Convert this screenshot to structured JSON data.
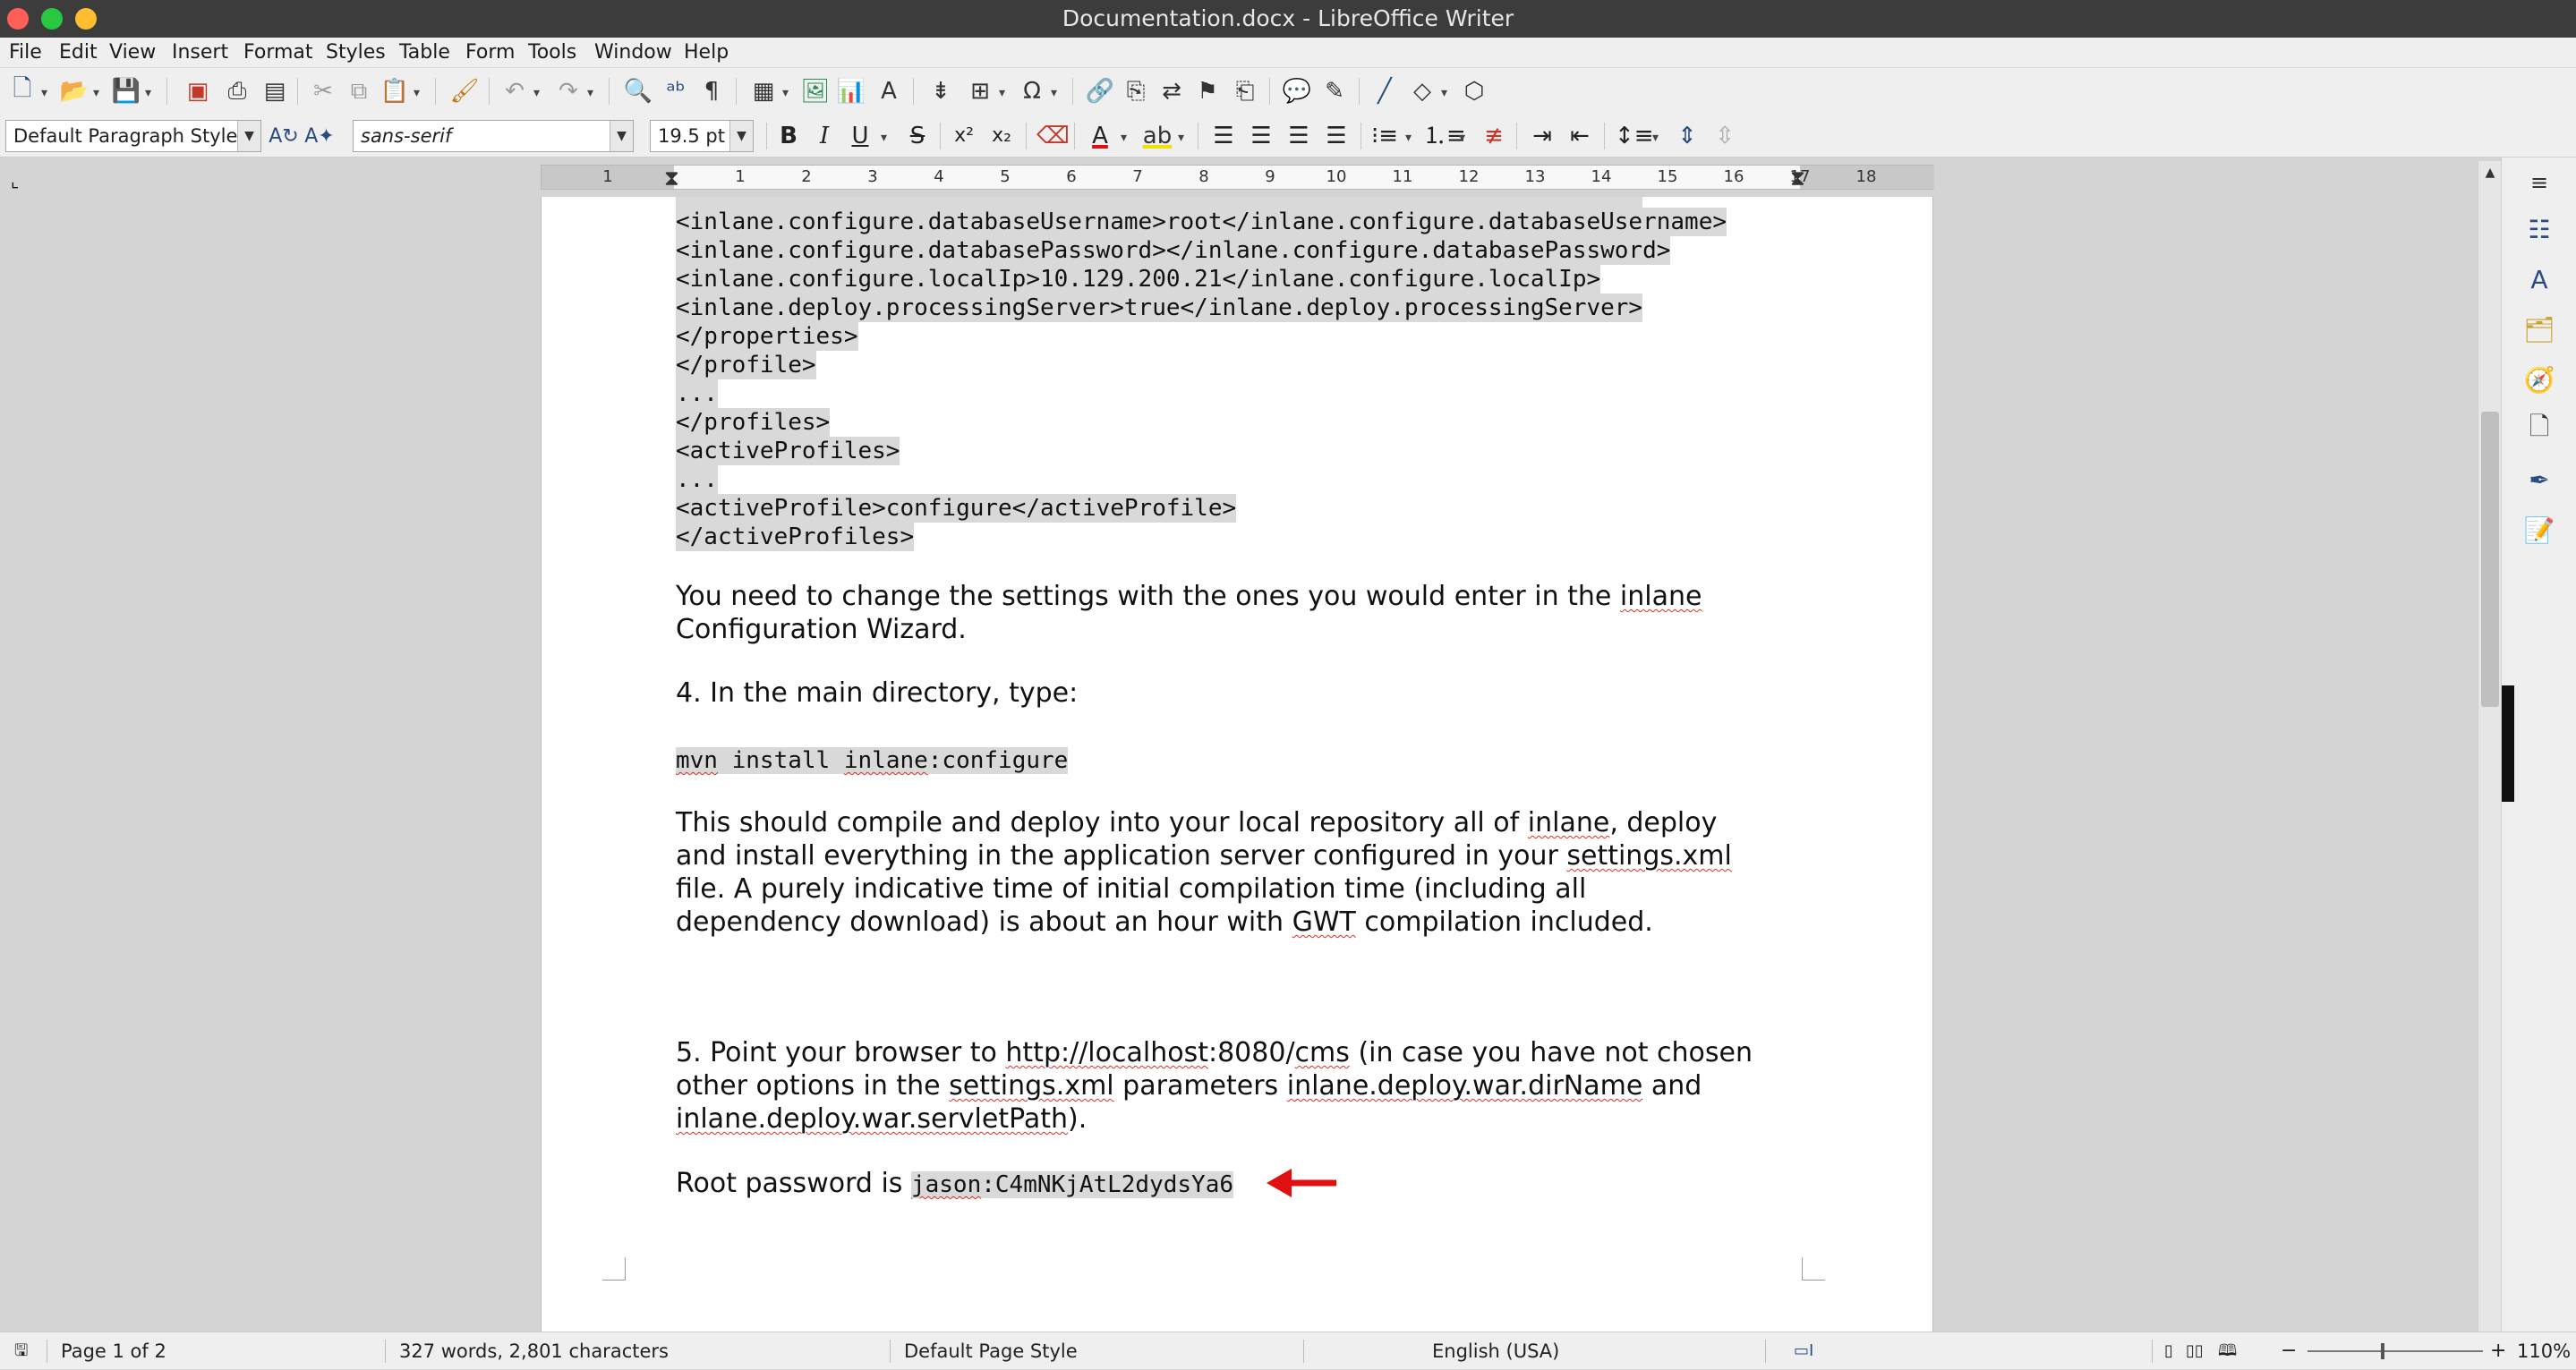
{
  "window": {
    "title": "Documentation.docx - LibreOffice Writer"
  },
  "menu": [
    "File",
    "Edit",
    "View",
    "Insert",
    "Format",
    "Styles",
    "Table",
    "Form",
    "Tools",
    "Window",
    "Help"
  ],
  "format_bar": {
    "paragraph_style": "Default Paragraph Style",
    "font_name": "sans-serif",
    "font_size": "19.5 pt",
    "bold": "B",
    "italic": "I",
    "underline": "U",
    "strike": "S"
  },
  "ruler": {
    "numbers": [
      "1",
      "1",
      "2",
      "3",
      "4",
      "5",
      "6",
      "7",
      "8",
      "9",
      "10",
      "11",
      "12",
      "13",
      "14",
      "15",
      "16",
      "17",
      "18"
    ]
  },
  "document": {
    "code_lines": [
      "<inlane.configure.databaseUsername>root</inlane.configure.databaseUsername>",
      "<inlane.configure.databasePassword></inlane.configure.databasePassword>",
      "<inlane.configure.localIp>10.129.200.21</inlane.configure.localIp>",
      "<inlane.deploy.processingServer>true</inlane.deploy.processingServer>",
      "</properties>",
      "</profile>",
      "...",
      "</profiles>",
      "<activeProfiles>",
      "...",
      "<activeProfile>configure</activeProfile>",
      "</activeProfiles>"
    ],
    "p1_line1_a": "You need to change the settings with the ones you would enter in the ",
    "p1_line1_b": "inlane",
    "p1_line2": "Configuration Wizard.",
    "step4": "4. In the main directory, type:",
    "cmd_a": "mvn",
    "cmd_b": " install ",
    "cmd_c": "inlane",
    "cmd_d": ":configure",
    "p2_line1_a": "This should compile and deploy into your local repository all of ",
    "p2_line1_b": "inlane",
    "p2_line1_c": ", deploy",
    "p2_line2_a": "and install everything in the application server configured in your ",
    "p2_line2_b": "settings.xml",
    "p2_line3": "file. A purely indicative time of initial compilation time (including all",
    "p2_line4_a": "dependency download) is about an hour with ",
    "p2_line4_b": "GWT",
    "p2_line4_c": " compilation included.",
    "step5_line1_a": "5. Point your browser to ",
    "step5_line1_b": "http://localhost",
    "step5_line1_c": ":8080/",
    "step5_line1_d": "cms",
    "step5_line1_e": " (in case you have not chosen",
    "step5_line2_a": "other options in the ",
    "step5_line2_b": "settings.xml",
    "step5_line2_c": " parameters ",
    "step5_line2_d": "inlane.deploy.war.dirName",
    "step5_line2_e": " and",
    "step5_line3_a": "inlane.deploy.war.servletPath",
    "step5_line3_b": ").",
    "root_label": "Root password is ",
    "root_value_a": "jason",
    "root_value_b": ":C4mNKjAtL2dydsYa6"
  },
  "annotation": {
    "arrow_color": "#e01010"
  },
  "status": {
    "page": "Page 1 of 2",
    "words": "327 words, 2,801 characters",
    "page_style": "Default Page Style",
    "language": "English (USA)",
    "zoom": "110%"
  }
}
